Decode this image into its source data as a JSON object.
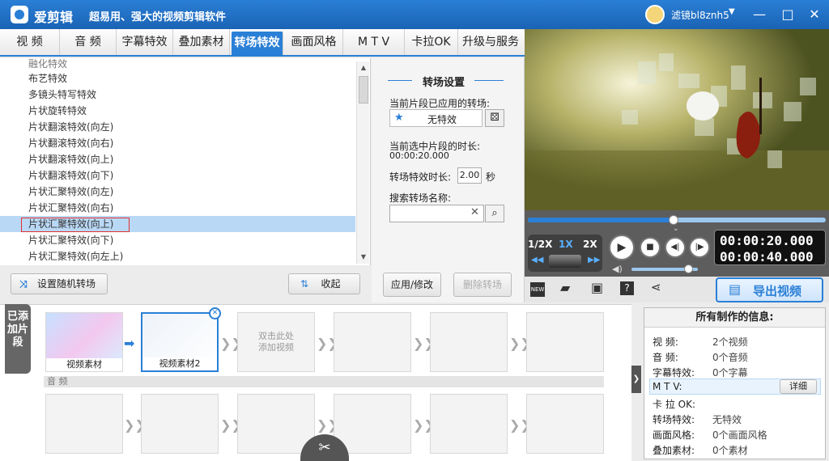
{
  "titlebar": {
    "app_name": "爱剪辑",
    "slogan": "超易用、强大的视频剪辑软件",
    "user_name": "滤镜bl8znh5",
    "minimize": "—",
    "maximize": "□",
    "close": "✕"
  },
  "tabs": [
    {
      "label": "视  频"
    },
    {
      "label": "音  频"
    },
    {
      "label": "字幕特效"
    },
    {
      "label": "叠加素材"
    },
    {
      "label": "转场特效"
    },
    {
      "label": "画面风格"
    },
    {
      "label": "M T V"
    },
    {
      "label": "卡拉OK"
    },
    {
      "label": "升级与服务"
    }
  ],
  "effects_list": [
    "融化特效",
    "布艺特效",
    "多镜头特写特效",
    "片状旋转特效",
    "片状翻滚特效(向左)",
    "片状翻滚特效(向右)",
    "片状翻滚特效(向上)",
    "片状翻滚特效(向下)",
    "片状汇聚特效(向左)",
    "片状汇聚特效(向右)",
    "片状汇聚特效(向上)",
    "片状汇聚特效(向下)",
    "片状汇聚特效(向左上)"
  ],
  "list_actions": {
    "random": "设置随机转场",
    "collapse": "收起"
  },
  "settings": {
    "title": "转场设置",
    "applied_label": "当前片段已应用的转场:",
    "applied_value": "无特效",
    "duration_label": "当前选中片段的时长:",
    "duration_value": "00:00:20.000",
    "effect_duration_label": "转场特效时长:",
    "effect_duration_value": "2.00",
    "effect_duration_unit": "秒",
    "search_label": "搜索转场名称:",
    "search_value": "",
    "apply": "应用/修改",
    "delete": "删除转场"
  },
  "player": {
    "speeds": [
      "1/2X",
      "1X",
      "2X"
    ],
    "time_current": "00:00:20.000",
    "time_total": "00:00:40.000",
    "export": "导出视频",
    "progress": 0.49,
    "volume": 0.85
  },
  "timeline": {
    "added_label": "已添加片段",
    "clips": [
      "视频素材",
      "视频素材2"
    ],
    "empty_hint": "双击此处添加视频",
    "audio_label": "音 频"
  },
  "info": {
    "title": "所有制作的信息:",
    "rows": [
      {
        "k": "视    频:",
        "v": "2个视频"
      },
      {
        "k": "音    频:",
        "v": "0个音频"
      },
      {
        "k": "字幕特效:",
        "v": "0个字幕"
      },
      {
        "k": "M  T  V:",
        "v": ""
      },
      {
        "k": "卡 拉 OK:",
        "v": ""
      },
      {
        "k": "转场特效:",
        "v": "无特效"
      },
      {
        "k": "画面风格:",
        "v": "0个画面风格"
      },
      {
        "k": "叠加素材:",
        "v": "0个素材"
      }
    ],
    "detail": "详细"
  },
  "colors": {
    "accent": "#2a7fd6",
    "selection": "#b9d8f5",
    "red_arrow": "#e03030"
  }
}
